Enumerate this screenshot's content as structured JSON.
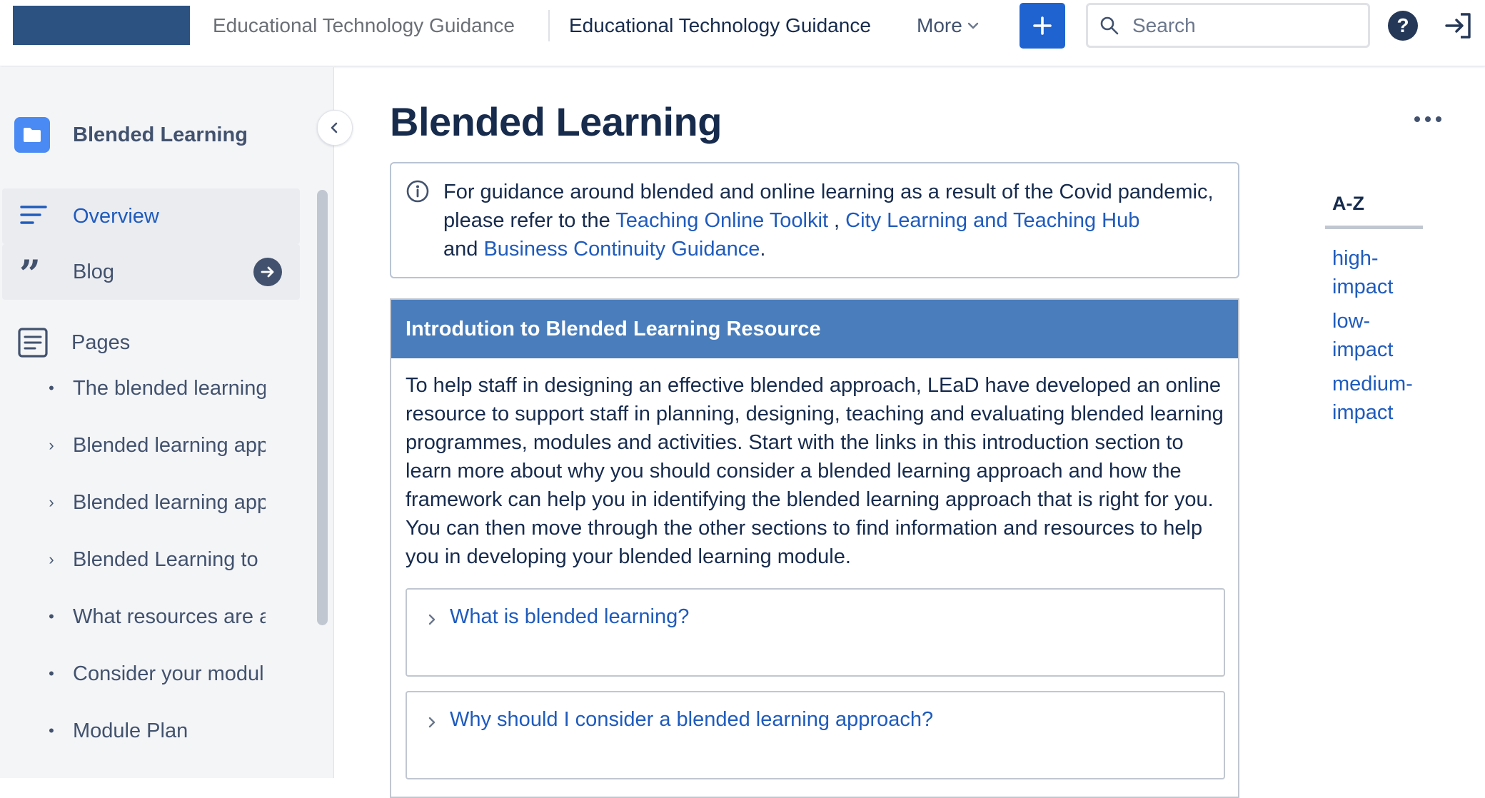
{
  "topbar": {
    "space_name": "Educational Technology Guidance",
    "space_title": "Educational Technology Guidance",
    "more_label": "More",
    "search_placeholder": "Search",
    "colors": {
      "logo": "#2c5282",
      "create_button": "#1f63d1"
    }
  },
  "sidebar": {
    "space_label": "Blended Learning",
    "nav": [
      {
        "label": "Overview",
        "icon": "overview-lines-icon"
      },
      {
        "label": "Blog",
        "icon": "quote-icon"
      }
    ],
    "pages_label": "Pages",
    "tree": [
      {
        "label": "The blended learning",
        "marker": "•"
      },
      {
        "label": "Blended learning app",
        "marker": "›"
      },
      {
        "label": "Blended learning app",
        "marker": "›"
      },
      {
        "label": "Blended Learning to",
        "marker": "›"
      },
      {
        "label": "What resources are a",
        "marker": "•"
      },
      {
        "label": "Consider your modul",
        "marker": "•"
      },
      {
        "label": "Module Plan",
        "marker": "•"
      }
    ]
  },
  "main": {
    "title": "Blended Learning",
    "info": {
      "text_1": "For guidance around blended and online learning as a result of the Covid pandemic, please refer to the ",
      "link_1": "Teaching Online Toolkit",
      "sep_1": " , ",
      "link_2": "City Learning and Teaching Hub",
      "text_2": " and ",
      "link_3": "Business Continuity Guidance",
      "text_3": "."
    },
    "resource": {
      "heading": "Introdution to Blended Learning Resource",
      "body": "To help staff in designing an effective blended approach, LEaD have developed an online resource to support staff in planning, designing, teaching and evaluating blended learning programmes, modules and activities. Start with the links in this introduction section to learn more about why you should consider a blended learning approach and how the framework can help you in identifying the blended learning approach that is right for you. You can then move through the other sections to find information and resources to help you in developing your blended learning module.",
      "expands": [
        {
          "label": "What is blended learning?"
        },
        {
          "label": "Why should I consider a blended learning approach?"
        }
      ]
    }
  },
  "az": {
    "title": "A-Z",
    "links": [
      "high-impact",
      "low-impact",
      "medium-impact"
    ]
  }
}
